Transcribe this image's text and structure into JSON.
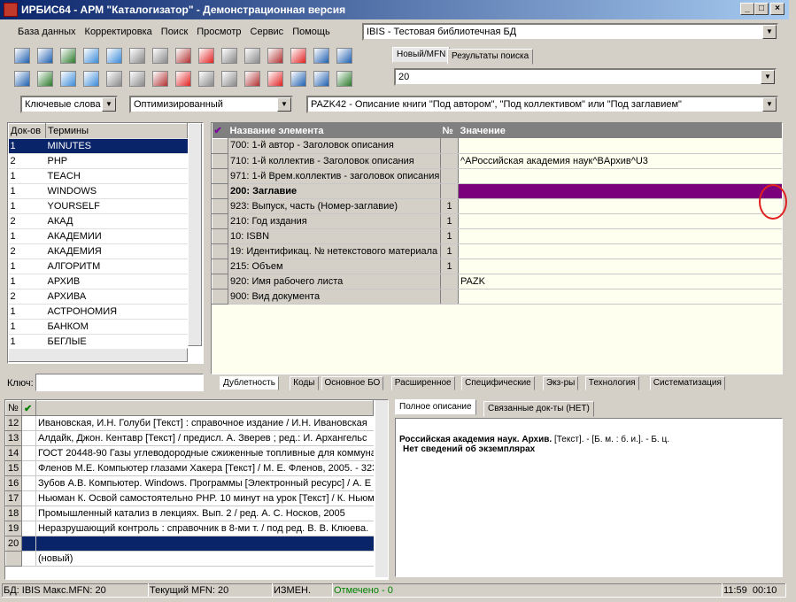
{
  "window": {
    "title": "ИРБИС64 - АРМ \"Каталогизатор\" - Демонстрационная версия"
  },
  "menu": [
    "База данных",
    "Корректировка",
    "Поиск",
    "Просмотр",
    "Сервис",
    "Помощь"
  ],
  "db_combo": "IBIS - Тестовая библиотечная БД",
  "search_tabs": [
    "Новый/MFN",
    "Результаты поиска"
  ],
  "mfn_value": "20",
  "filters": {
    "mode": "Ключевые слова",
    "opt": "Оптимизированный",
    "worksheet": "PAZK42 - Описание книги \"Под автором\", \"Под коллективом\" или \"Под заглавием\""
  },
  "terms": {
    "headers": [
      "Док-ов",
      "Термины"
    ],
    "rows": [
      [
        "1",
        "MINUTES"
      ],
      [
        "2",
        "PHP"
      ],
      [
        "1",
        "TEACH"
      ],
      [
        "1",
        "WINDOWS"
      ],
      [
        "1",
        "YOURSELF"
      ],
      [
        "2",
        "АКАД"
      ],
      [
        "1",
        "АКАДЕМИИ"
      ],
      [
        "2",
        "АКАДЕМИЯ"
      ],
      [
        "1",
        "АЛГОРИТМ"
      ],
      [
        "1",
        "АРХИВ"
      ],
      [
        "2",
        "АРХИВА"
      ],
      [
        "1",
        "АСТРОНОМИЯ"
      ],
      [
        "1",
        "БАНКОМ"
      ],
      [
        "1",
        "БЕГЛЫЕ"
      ]
    ],
    "key_label": "Ключ:"
  },
  "elements": {
    "headers": [
      "Название элемента",
      "№",
      "Значение"
    ],
    "rows": [
      [
        "700: 1-й автор - Заголовок описания",
        "",
        ""
      ],
      [
        "710: 1-й коллектив - Заголовок описания",
        "",
        "^AРоссийская академия наук^BАрхив^U3"
      ],
      [
        "971: 1-й Врем.коллектив - заголовок описания",
        "",
        ""
      ],
      [
        "200: Заглавие",
        "",
        ""
      ],
      [
        "923: Выпуск, часть (Номер-заглавие)",
        "1",
        ""
      ],
      [
        "210: Год издания",
        "1",
        ""
      ],
      [
        "10: ISBN",
        "1",
        ""
      ],
      [
        "19: Идентификац. № нетекстового материала",
        "1",
        ""
      ],
      [
        "215: Объем",
        "1",
        ""
      ],
      [
        "920: Имя рабочего листа",
        "",
        "PAZK"
      ],
      [
        "900: Вид документа",
        "",
        ""
      ]
    ],
    "ellipsis": "..."
  },
  "bottom_tabs": [
    "Дублетность",
    "Коды",
    "Основное БО",
    "Расширенное",
    "Специфические",
    "Экз-ры",
    "Технология",
    "Систематизация"
  ],
  "records": {
    "header_no": "№",
    "rows": [
      [
        "12",
        "Ивановская, И.Н. Голуби [Текст] : справочное издание / И.Н. Ивановская"
      ],
      [
        "13",
        "Алдайк, Джон. Кентавр [Текст] / предисл. А. Зверев ; ред.: И. Архангельс"
      ],
      [
        "14",
        "ГОСТ 20448-90 Газы углеводородные сжиженные топливные для коммуна"
      ],
      [
        "15",
        "Фленов М.Е. Компьютер глазами Хакера [Текст] / М. Е. Фленов, 2005. - 323"
      ],
      [
        "16",
        "Зубов А.В. Компьютер. Windows. Программы [Электронный ресурс] / А. Е"
      ],
      [
        "17",
        "Ньюман К. Освой самостоятельно PHP. 10 минут на урок [Текст] / К. Ньюм"
      ],
      [
        "18",
        "Промышленный катализ в лекциях. Вып. 2 / ред. А. С. Носков, 2005"
      ],
      [
        "19",
        "Неразрушающий контроль : справочник в 8-ми т. / под ред. В. В. Клюева. "
      ],
      [
        "20",
        ""
      ],
      [
        "",
        "(новый)"
      ]
    ]
  },
  "desc_tabs": [
    "Полное описание",
    "Связанные док-ты (НЕТ)"
  ],
  "desc": {
    "line1_bold": "Российская академия наук. Архив.",
    "line1_rest": " [Текст]. - [Б. м. : б. и.]. - Б. ц.",
    "line2": "Нет сведений об экземплярах"
  },
  "status": {
    "db": "БД: IBIS Макс.MFN: 20",
    "cur": "Текущий MFN: 20",
    "mod": "ИЗМЕН.",
    "marked": "Отмечено - 0",
    "time": "11:59",
    "time2": "00:10"
  }
}
